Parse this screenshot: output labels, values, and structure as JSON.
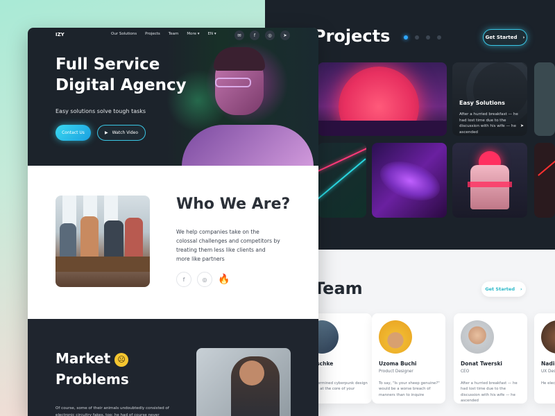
{
  "back": {
    "projects_title": "Projects",
    "get_started": "Get Started",
    "easy_title": "Easy Solutions",
    "easy_desc": "After a hurried breakfast — he had lost time due to the discussion with his wife — he ascended",
    "team_title": "Team",
    "team_get_started": "Get Started",
    "members": [
      {
        "name": "Kauschke",
        "role": "",
        "bio": "predetermined cyberpunk design system at the core of your project"
      },
      {
        "name": "Uzoma Buchi",
        "role": "Product Designer",
        "bio": "To say, \"Is your sheep genuine?\" would be a worse breach of manners than to inquire"
      },
      {
        "name": "Donat Twerski",
        "role": "CEO",
        "bio": "After a hurried breakfast — he had lost time due to the discussion with his wife — he ascended"
      },
      {
        "name": "Nadir",
        "role": "UX Des",
        "bio": "He elect Whereso with his"
      }
    ]
  },
  "front": {
    "logo": "IZY",
    "nav": [
      "Our Solutions",
      "Projects",
      "Team",
      "More ▾",
      "EN ▾"
    ],
    "hero_title_1": "Full Service",
    "hero_title_2": "Digital Agency",
    "hero_subtitle": "Easy solutions solve tough tasks",
    "contact_btn": "Contact Us",
    "watch_btn": "Watch Video",
    "who_title": "Who We Are?",
    "who_text": "We help companies take on the colossal challenges and competitors by treating them less like clients and more like partners",
    "market_title_1": "Market",
    "market_title_2": "Problems",
    "market_text": "Of course, some of their animals undoubtedly consisted of electronic circuitry fakes, too; he had of course never"
  },
  "colors": {
    "accent": "#3ac7e6",
    "dark": "#1c232b",
    "light": "#f4f5f7"
  }
}
